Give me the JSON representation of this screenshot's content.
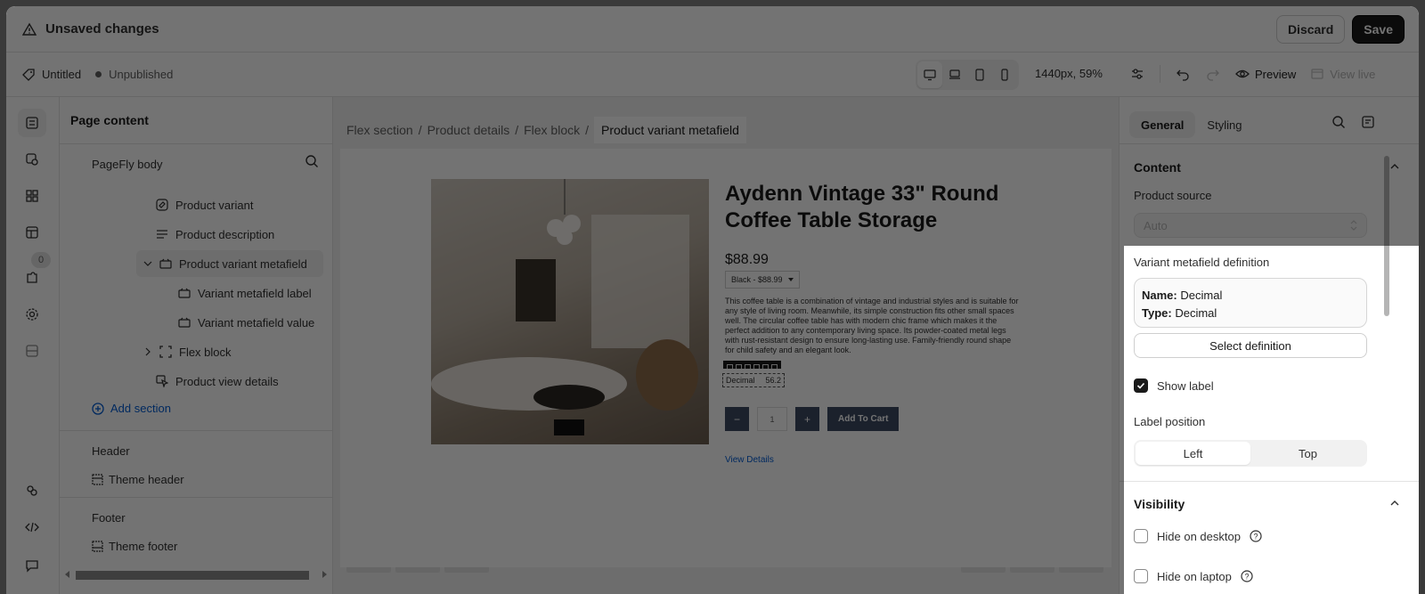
{
  "topbar": {
    "title": "Unsaved changes",
    "discard": "Discard",
    "save": "Save"
  },
  "toolbar": {
    "page_name": "Untitled",
    "status": "Unpublished",
    "zoom": "1440px, 59%",
    "preview": "Preview",
    "view_live": "View live"
  },
  "rail": {
    "badge": "0"
  },
  "panel": {
    "title": "Page content",
    "body": "PageFly body",
    "items": [
      {
        "label": "Product variant",
        "icon": "variant-icon"
      },
      {
        "label": "Product description",
        "icon": "text-icon"
      },
      {
        "label": "Product variant metafield",
        "icon": "metafield-icon"
      },
      {
        "label": "Variant metafield label",
        "icon": "metafield-icon"
      },
      {
        "label": "Variant metafield value",
        "icon": "metafield-icon"
      },
      {
        "label": "Flex block",
        "icon": "flex-block-icon"
      },
      {
        "label": "Product view details",
        "icon": "cursor-icon"
      }
    ],
    "add_section": "Add section",
    "header": "Header",
    "theme_header": "Theme header",
    "footer": "Footer",
    "theme_footer": "Theme footer"
  },
  "breadcrumb": [
    "Flex section",
    "Product details",
    "Flex block",
    "Product variant metafield"
  ],
  "product": {
    "title": "Aydenn Vintage 33\" Round Coffee Table Storage",
    "price": "$88.99",
    "variant": "Black - $88.99",
    "description": "This coffee table is a combination of vintage and industrial styles and is suitable for any style of living room. Meanwhile, its simple construction fits other small spaces well. The circular coffee table has with modern chic frame which makes it the perfect addition to any contemporary living space. Its powder-coated metal legs with rust-resistant design to ensure long-lasting use. Family-friendly round shape for child safety and an elegant look.",
    "metafield_label": "Decimal",
    "metafield_value": "56.2",
    "qty": "1",
    "minus": "−",
    "plus": "+",
    "add_to_cart": "Add To Cart",
    "view_details": "View Details"
  },
  "props": {
    "tabs": [
      "General",
      "Styling"
    ],
    "content": "Content",
    "product_source": "Product source",
    "product_source_value": "Auto",
    "definition_title": "Variant metafield definition",
    "name_label": "Name:",
    "name_value": "Decimal",
    "type_label": "Type:",
    "type_value": "Decimal",
    "select_definition": "Select definition",
    "show_label": "Show label",
    "label_position": "Label position",
    "positions": [
      "Left",
      "Top"
    ],
    "visibility": "Visibility",
    "hide_desktop": "Hide on desktop",
    "hide_laptop": "Hide on laptop"
  }
}
